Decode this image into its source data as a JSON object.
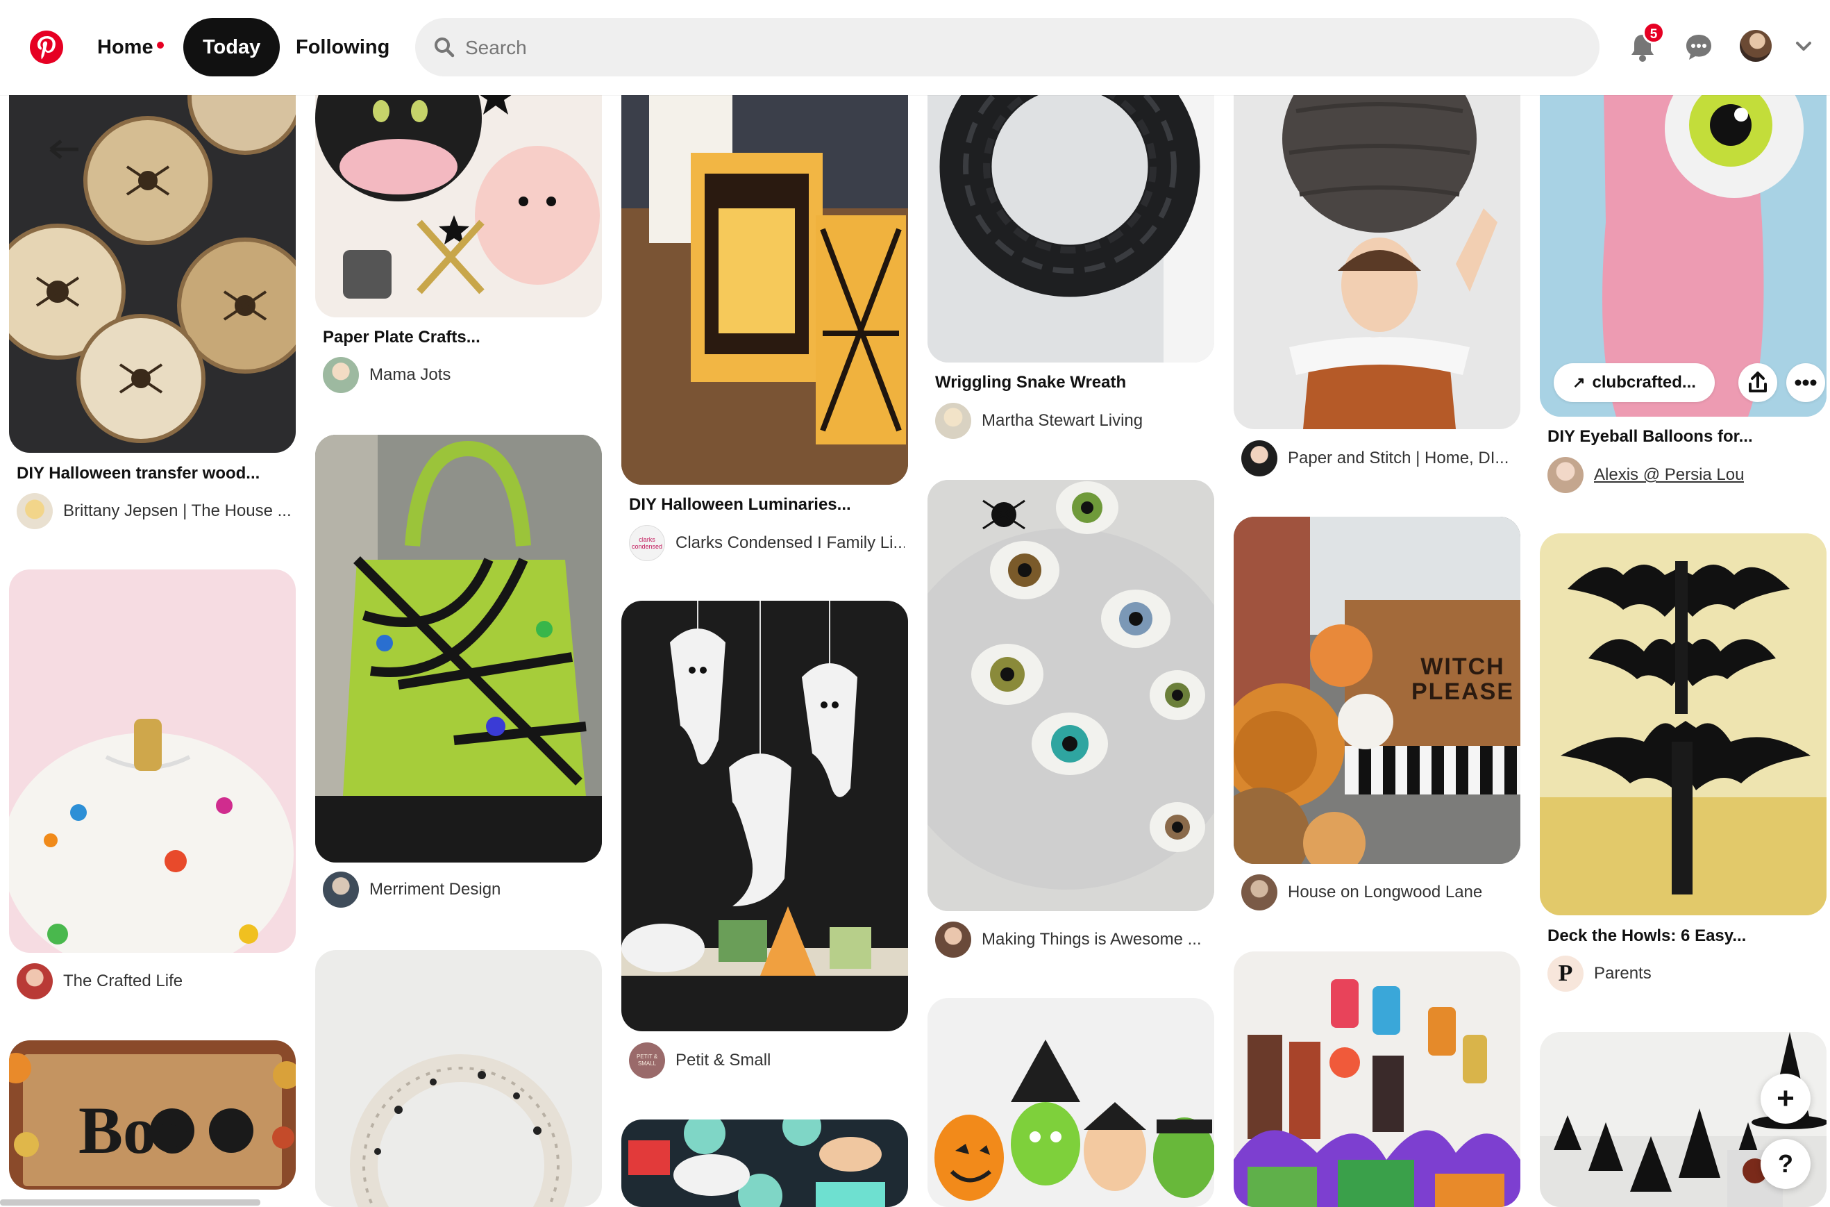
{
  "header": {
    "nav": {
      "home": "Home",
      "today": "Today",
      "following": "Following"
    },
    "search_placeholder": "Search",
    "notification_count": "5"
  },
  "pins": [
    {
      "title": "DIY Halloween transfer wood...",
      "author": "Brittany Jepsen | The House ..."
    },
    {
      "title": "",
      "author": "The Crafted Life"
    },
    {
      "title": "Paper Plate Crafts...",
      "author": "Mama Jots"
    },
    {
      "title": "",
      "author": "Merriment Design"
    },
    {
      "title": "DIY Halloween Luminaries...",
      "author": "Clarks Condensed I Family Li..."
    },
    {
      "title": "",
      "author": "Petit & Small"
    },
    {
      "title": "Wriggling Snake Wreath",
      "author": "Martha Stewart Living"
    },
    {
      "title": "",
      "author": "Making Things is Awesome ..."
    },
    {
      "title": "",
      "author": "Paper and Stitch | Home, DI..."
    },
    {
      "title": "",
      "author": "House on Longwood Lane"
    },
    {
      "title": "DIY Eyeball Balloons for...",
      "author": "Alexis @ Persia Lou",
      "link": "clubcrafted..."
    },
    {
      "title": "Deck the Howls: 6 Easy...",
      "author": "Parents"
    }
  ],
  "image_text": {
    "boo_mat": "Boo",
    "witch_mat_line1": "WITCH",
    "witch_mat_line2": "PLEASE",
    "clarks_avatar": "clarks condensed",
    "parents_avatar": "P",
    "petit_avatar": "PETIT & SMALL"
  },
  "floating": {
    "add": "+",
    "help": "?"
  }
}
